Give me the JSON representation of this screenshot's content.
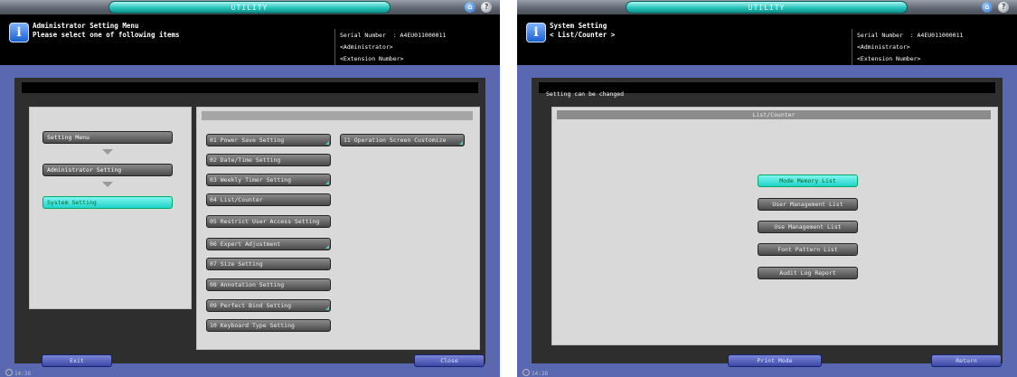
{
  "left": {
    "utility_label": "UTILITY",
    "header": {
      "line1": "Administrator Setting Menu",
      "line2": "Please select one of following items"
    },
    "serial": {
      "label": "Serial Number",
      "value": ": A4EU011000011",
      "line2": "<Administrator>",
      "line3": "<Extension Number>"
    },
    "menu": [
      "Setting Menu",
      "Administrator Setting",
      "System Setting"
    ],
    "items": [
      "01 Power Save Setting",
      "02 Date/Time Setting",
      "03 Weekly Timer Setting",
      "04 List/Counter",
      "05 Restrict User Access Setting",
      "06 Expert Adjustment",
      "07 Size Setting",
      "08 Annotation Setting",
      "09 Perfect Bind Setting",
      "10 Keyboard Type Setting",
      "11 Operation Screen Customize"
    ],
    "exit_label": "Exit",
    "close_label": "Close",
    "clock": "14:38"
  },
  "right": {
    "utility_label": "UTILITY",
    "header": {
      "line1": "System Setting",
      "line2": "< List/Counter >"
    },
    "serial": {
      "label": "Serial Number",
      "value": ": A4EU011000011",
      "line2": "<Administrator>",
      "line3": "<Extension Number>"
    },
    "status": "Setting can be changed",
    "panel_title": "List/Counter",
    "list_buttons": [
      "Mode Memory List",
      "User Management List",
      "Use Management List",
      "Font Pattern List",
      "Audit Log Report"
    ],
    "print_mode_label": "Print Mode",
    "return_label": "Return",
    "clock": "14:38"
  },
  "colors": {
    "accent_cyan": "#1fd3c8",
    "frame_blue": "#5968b0"
  }
}
